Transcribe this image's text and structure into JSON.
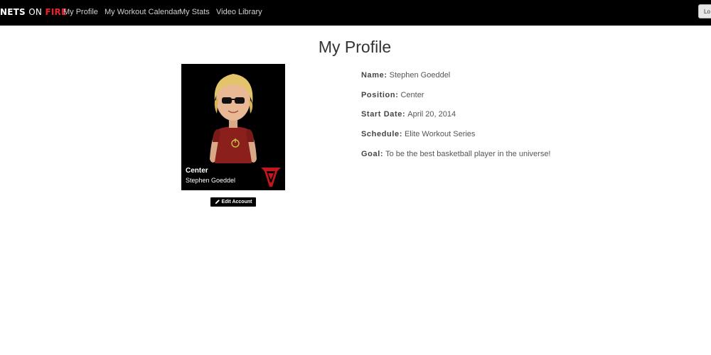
{
  "navbar": {
    "brand": {
      "part1": "NETS",
      "part2": "ON",
      "part3": "FIRE"
    },
    "links": [
      "My Profile",
      "My Workout Calendar",
      "My Stats",
      "Video Library"
    ],
    "logout_label": "Lo"
  },
  "page": {
    "title": "My Profile"
  },
  "card": {
    "position": "Center",
    "name": "Stephen Goeddel"
  },
  "edit_button": {
    "label": "Edit Account",
    "icon": "pencil-icon"
  },
  "profile": {
    "fields": [
      {
        "label": "Name:",
        "value": "Stephen Goeddel"
      },
      {
        "label": "Position:",
        "value": "Center"
      },
      {
        "label": "Start Date:",
        "value": "April 20, 2014"
      },
      {
        "label": "Schedule:",
        "value": "Elite Workout Series"
      },
      {
        "label": "Goal:",
        "value": "To be the best basketball player in the universe!"
      }
    ]
  },
  "colors": {
    "navbar_bg": "#000000",
    "brand_accent": "#e8222a",
    "card_bg": "#000000"
  }
}
